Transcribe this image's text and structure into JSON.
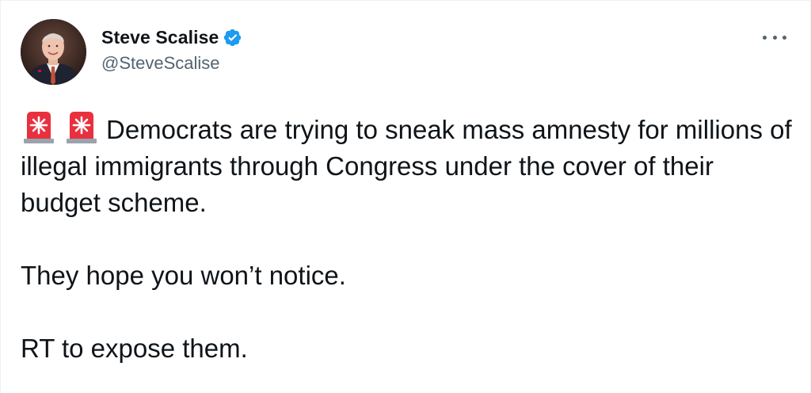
{
  "tweet": {
    "display_name": "Steve Scalise",
    "handle": "@SteveScalise",
    "verified": true,
    "verified_icon": "verified-badge-icon",
    "avatar_icon": "avatar-photo",
    "more_icon": "more-options-icon",
    "text_line1": "Democrats are trying to sneak mass amnesty for millions of illegal immigrants through Congress under the cover of their budget scheme.",
    "text_line2": "They hope you won’t notice.",
    "text_line3": "RT to expose them.",
    "emoji": [
      "police-car-light-icon",
      "police-car-light-icon"
    ]
  },
  "colors": {
    "verified": "#1d9bf0",
    "text": "#0f1419",
    "secondary": "#536471",
    "siren_red": "#e8303f"
  }
}
